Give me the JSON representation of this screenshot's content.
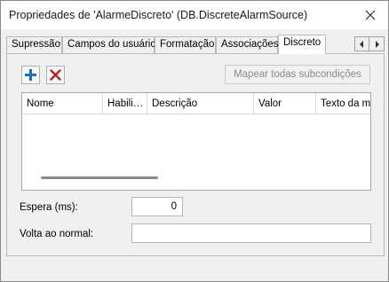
{
  "window": {
    "title": "Propriedades de 'AlarmeDiscreto' (DB.DiscreteAlarmSource)"
  },
  "tabs": [
    {
      "label": "Supressão"
    },
    {
      "label": "Campos do usuário"
    },
    {
      "label": "Formatação"
    },
    {
      "label": "Associações"
    },
    {
      "label": "Discreto",
      "active": true
    }
  ],
  "toolbar": {
    "map_button_label": "Mapear todas subcondições"
  },
  "grid": {
    "columns": [
      "Nome",
      "Habili…",
      "Descrição",
      "Valor",
      "Texto da m"
    ],
    "rows": []
  },
  "form": {
    "delay_label": "Espera (ms):",
    "delay_value": "0",
    "return_label": "Volta ao normal:",
    "return_value": ""
  },
  "icons": {
    "add": "plus-icon",
    "delete": "x-icon",
    "close": "close-icon",
    "tab_left": "chevron-left-icon",
    "tab_right": "chevron-right-icon"
  },
  "colors": {
    "add_icon": "#1d6fb8",
    "delete_icon": "#b0231b",
    "disabled_text": "#8c8c8c"
  }
}
